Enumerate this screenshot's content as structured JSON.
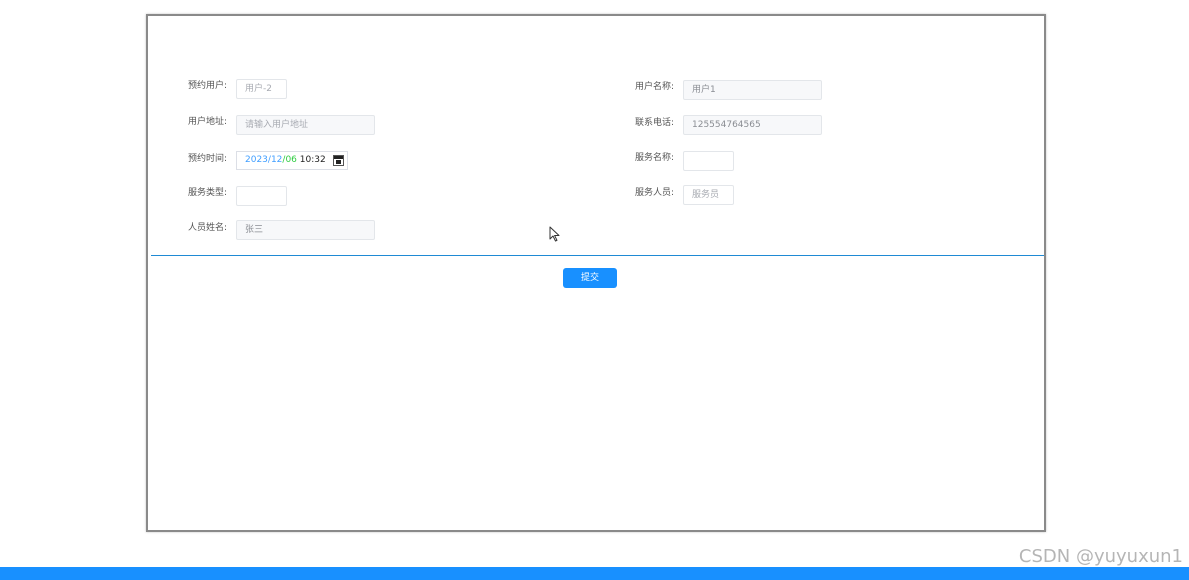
{
  "form": {
    "left": [
      {
        "label": "预约用户:",
        "value": "用户-2"
      },
      {
        "label": "用户地址:",
        "placeholder": "请输入用户地址"
      },
      {
        "label": "预约时间:"
      },
      {
        "label": "服务类型:",
        "value": ""
      },
      {
        "label": "人员姓名:",
        "value": "张三"
      }
    ],
    "right": [
      {
        "label": "用户名称:",
        "value": "用户1"
      },
      {
        "label": "联系电话:",
        "value": "125554764565"
      },
      {
        "label": "服务名称:",
        "value": ""
      },
      {
        "label": "服务人员:",
        "value": "服务员"
      }
    ],
    "datetime": {
      "year": "2023",
      "sep1": "/",
      "month": "12",
      "sep2": "/",
      "day": "06",
      "time": " 10:32"
    },
    "submit_label": "提交"
  },
  "watermark": "CSDN @yuyuxun1",
  "colors": {
    "accent": "#1890ff",
    "divider": "#1f8ad4"
  },
  "icons": {
    "calendar": "calendar-icon",
    "cursor": "mouse-pointer-icon"
  }
}
